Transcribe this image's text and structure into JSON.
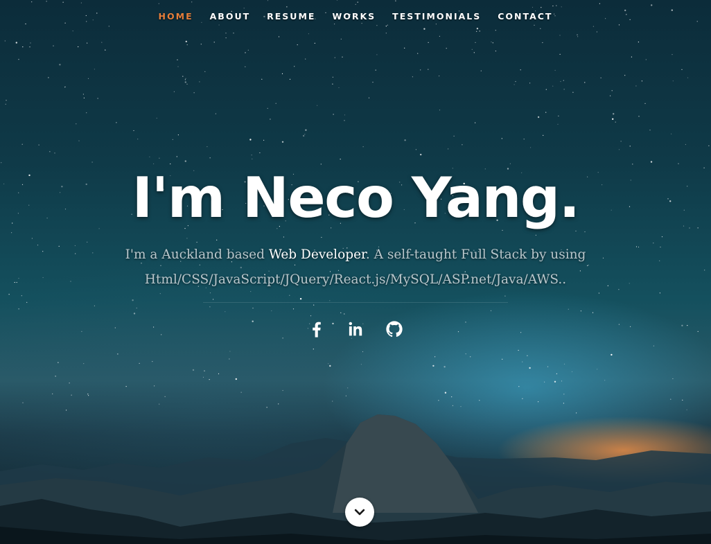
{
  "nav": {
    "items": [
      {
        "label": "HOME",
        "active": true
      },
      {
        "label": "ABOUT",
        "active": false
      },
      {
        "label": "RESUME",
        "active": false
      },
      {
        "label": "WORKS",
        "active": false
      },
      {
        "label": "TESTIMONIALS",
        "active": false
      },
      {
        "label": "CONTACT",
        "active": false
      }
    ],
    "active_color": "#e67e3a"
  },
  "hero": {
    "title": "I'm Neco Yang.",
    "intro_before": "I'm a Auckland based ",
    "intro_highlight": "Web Developer",
    "intro_after": ". A self-taught Full Stack by using Html/CSS/JavaScript/JQuery/React.js/MySQL/ASP.net/Java/AWS.."
  },
  "social": [
    {
      "icon": "facebook-icon"
    },
    {
      "icon": "linkedin-icon"
    },
    {
      "icon": "github-icon"
    }
  ],
  "scroll_button": {
    "icon": "chevron-down-icon"
  }
}
